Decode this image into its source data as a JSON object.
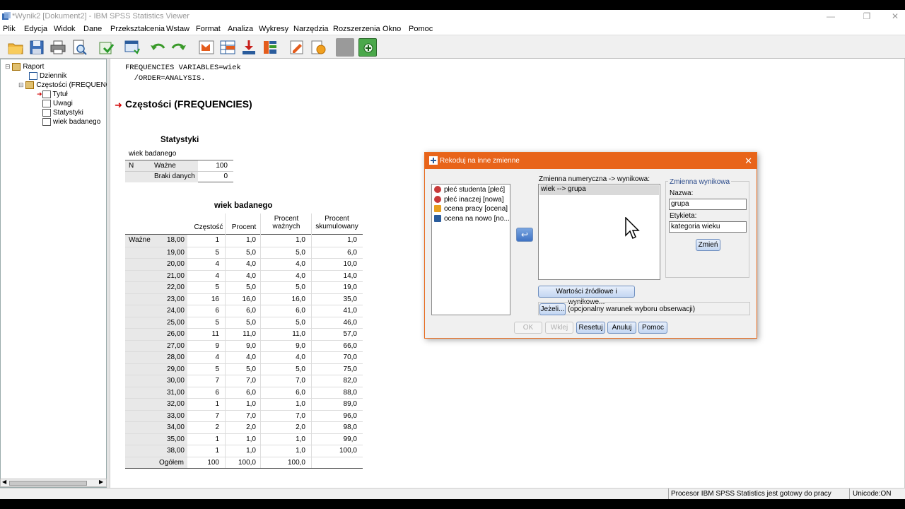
{
  "window": {
    "title": "*Wynik2 [Dokument2] - IBM SPSS Statistics Viewer",
    "minimize": "—",
    "restore": "❐",
    "close": "✕"
  },
  "menu": [
    "Plik",
    "Edycja",
    "Widok",
    "Dane",
    "Przekształcenia",
    "Wstaw",
    "Format",
    "Analiza",
    "Wykresy",
    "Narzędzia",
    "Rozszerzenia",
    "Okno",
    "Pomoc"
  ],
  "toolbar": [
    "open-icon",
    "save-icon",
    "print-icon",
    "print-preview-icon",
    "export-icon",
    "recall-dialog-icon",
    "undo-icon",
    "redo-icon",
    "goto-data-icon",
    "goto-case-icon",
    "goto-variable-icon",
    "variables-icon",
    "show-all-icon",
    "insert-output-icon",
    "designate-window-icon",
    "disabled-icon",
    "add-icon"
  ],
  "tree": {
    "root": "Raport",
    "log": "Dziennik",
    "freq": "Częstości (FREQUENCIES)",
    "title": "Tytuł",
    "notes": "Uwagi",
    "stats": "Statystyki",
    "table": "wiek badanego"
  },
  "output": {
    "syntax": "FREQUENCIES VARIABLES=wiek\n  /ORDER=ANALYSIS.",
    "section_title": "Częstości (FREQUENCIES)",
    "stats_table": {
      "title": "Statystyki",
      "subtitle": "wiek badanego",
      "n": "N",
      "valid": "Ważne",
      "valid_value": "100",
      "missing": "Braki danych",
      "missing_value": "0"
    },
    "freq_table": {
      "title": "wiek badanego",
      "headers": [
        "Częstość",
        "Procent",
        "Procent ważnych",
        "Procent skumulowany"
      ],
      "group_label": "Ważne",
      "rows": [
        [
          "18,00",
          "1",
          "1,0",
          "1,0",
          "1,0"
        ],
        [
          "19,00",
          "5",
          "5,0",
          "5,0",
          "6,0"
        ],
        [
          "20,00",
          "4",
          "4,0",
          "4,0",
          "10,0"
        ],
        [
          "21,00",
          "4",
          "4,0",
          "4,0",
          "14,0"
        ],
        [
          "22,00",
          "5",
          "5,0",
          "5,0",
          "19,0"
        ],
        [
          "23,00",
          "16",
          "16,0",
          "16,0",
          "35,0"
        ],
        [
          "24,00",
          "6",
          "6,0",
          "6,0",
          "41,0"
        ],
        [
          "25,00",
          "5",
          "5,0",
          "5,0",
          "46,0"
        ],
        [
          "26,00",
          "11",
          "11,0",
          "11,0",
          "57,0"
        ],
        [
          "27,00",
          "9",
          "9,0",
          "9,0",
          "66,0"
        ],
        [
          "28,00",
          "4",
          "4,0",
          "4,0",
          "70,0"
        ],
        [
          "29,00",
          "5",
          "5,0",
          "5,0",
          "75,0"
        ],
        [
          "30,00",
          "7",
          "7,0",
          "7,0",
          "82,0"
        ],
        [
          "31,00",
          "6",
          "6,0",
          "6,0",
          "88,0"
        ],
        [
          "32,00",
          "1",
          "1,0",
          "1,0",
          "89,0"
        ],
        [
          "33,00",
          "7",
          "7,0",
          "7,0",
          "96,0"
        ],
        [
          "34,00",
          "2",
          "2,0",
          "2,0",
          "98,0"
        ],
        [
          "35,00",
          "1",
          "1,0",
          "1,0",
          "99,0"
        ],
        [
          "38,00",
          "1",
          "1,0",
          "1,0",
          "100,0"
        ]
      ],
      "total": [
        "Ogółem",
        "100",
        "100,0",
        "100,0",
        ""
      ]
    }
  },
  "dialog": {
    "title": "Rekoduj na inne zmienne",
    "close": "✕",
    "variables": [
      "płeć studenta [płeć]",
      "płeć inaczej [nowa]",
      "ocena pracy [ocena]",
      "ocena na nowo [no..."
    ],
    "mapping_label": "Zmienna numeryczna -> wynikowa:",
    "mapping_items": [
      "wiek --> grupa"
    ],
    "output_group": "Zmienna wynikowa",
    "name_label": "Nazwa:",
    "name_value": "grupa",
    "label_label": "Etykieta:",
    "label_value": "kategoria wieku",
    "change_btn": "Zmień",
    "old_new_btn": "Wartości źródłowe i wynikowe...",
    "if_btn": "Jeżeli...",
    "if_text": "(opcjonalny warunek wyboru obserwacji)",
    "buttons": {
      "ok": "OK",
      "paste": "Wklej",
      "reset": "Resetuj",
      "cancel": "Anuluj",
      "help": "Pomoc"
    }
  },
  "status": {
    "processor": "Procesor IBM SPSS Statistics  jest gotowy do pracy",
    "unicode": "Unicode:ON"
  }
}
